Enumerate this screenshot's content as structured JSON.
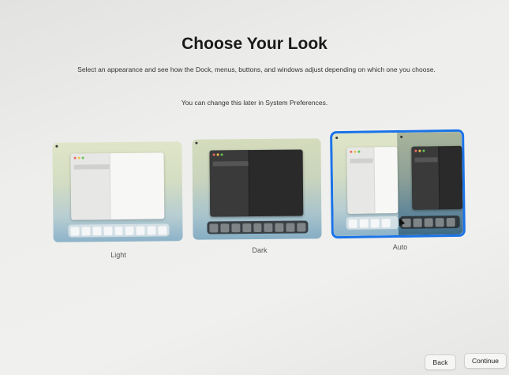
{
  "header": {
    "title": "Choose Your Look",
    "subtitle": "Select an appearance and see how the Dock, menus, buttons, and windows adjust depending on which one you choose.",
    "note": "You can change this later in System Preferences."
  },
  "options": [
    {
      "label": "Light",
      "selected": false
    },
    {
      "label": "Dark",
      "selected": false
    },
    {
      "label": "Auto",
      "selected": true
    }
  ],
  "footer": {
    "back_label": "Back",
    "continue_label": "Continue"
  },
  "colors": {
    "selection": "#1a73e8",
    "traffic_red": "#ec6a5e",
    "traffic_yellow": "#f4bf4f",
    "traffic_green": "#61c554"
  }
}
